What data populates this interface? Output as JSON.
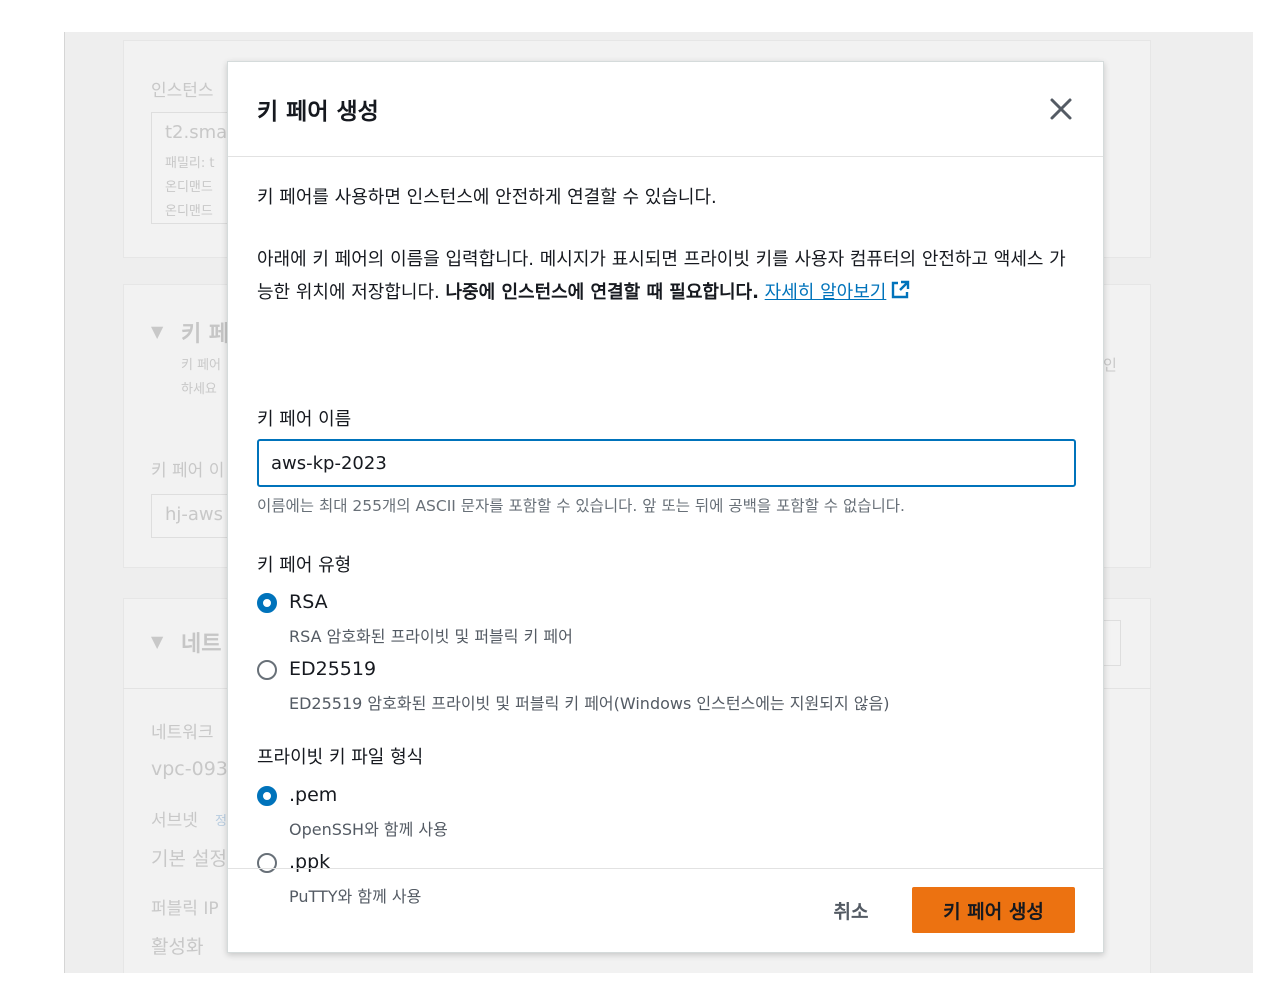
{
  "background": {
    "instance_label": "인스턴스",
    "instance_type": "t2.sma",
    "family": "패밀리: t",
    "ondemand1": "온디맨드",
    "ondemand2": "온디맨드",
    "keypair_section": "키 페",
    "keypair_desc1": "키 페어",
    "keypair_desc2": "하세요",
    "keypair_name_label": "키 페어 이",
    "keypair_name_value": "hj-aws",
    "network_section": "네트",
    "network_label": "네트워크",
    "vpc_value": "vpc-093",
    "subnet_label": "서브넷",
    "subnet_info": "정",
    "default_setting": "기본 설정",
    "public_ip_label": "퍼블릭 IP",
    "enable": "활성화",
    "right_fragment": "인"
  },
  "modal": {
    "title": "키 페어 생성",
    "intro": "키 페어를 사용하면 인스턴스에 안전하게 연결할 수 있습니다.",
    "desc_plain": "아래에 키 페어의 이름을 입력합니다. 메시지가 표시되면 프라이빗 키를 사용자 컴퓨터의 안전하고 액세스 가능한 위치에 저장합니다. ",
    "desc_bold": "나중에 인스턴스에 연결할 때 필요합니다.",
    "learn_more": "자세히 알아보기",
    "name_label": "키 페어 이름",
    "name_value": "aws-kp-2023",
    "name_hint": "이름에는 최대 255개의 ASCII 문자를 포함할 수 있습니다. 앞 또는 뒤에 공백을 포함할 수 없습니다.",
    "type_label": "키 페어 유형",
    "type_options": [
      {
        "label": "RSA",
        "desc": "RSA 암호화된 프라이빗 및 퍼블릭 키 페어",
        "checked": true
      },
      {
        "label": "ED25519",
        "desc": "ED25519 암호화된 프라이빗 및 퍼블릭 키 페어(Windows 인스턴스에는 지원되지 않음)",
        "checked": false
      }
    ],
    "format_label": "프라이빗 키 파일 형식",
    "format_options": [
      {
        "label": ".pem",
        "desc": "OpenSSH와 함께 사용",
        "checked": true
      },
      {
        "label": ".ppk",
        "desc": "PuTTY와 함께 사용",
        "checked": false
      }
    ],
    "cancel_label": "취소",
    "create_label": "키 페어 생성"
  },
  "colors": {
    "primary_blue": "#0073bb",
    "orange_button": "#ec7211"
  }
}
